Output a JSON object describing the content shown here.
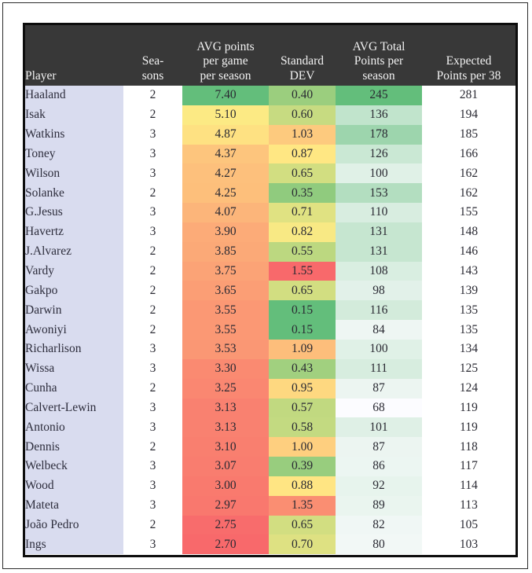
{
  "table": {
    "columns": [
      {
        "key": "player",
        "label": "Player",
        "lines": [
          "Player"
        ]
      },
      {
        "key": "seasons",
        "label": "Seasons",
        "lines": [
          "Sea-",
          "sons"
        ]
      },
      {
        "key": "avg_ppg",
        "label": "AVG points per game per season",
        "lines": [
          "AVG points",
          "per game",
          "per season"
        ]
      },
      {
        "key": "std_dev",
        "label": "Standard DEV",
        "lines": [
          "Standard",
          "DEV"
        ]
      },
      {
        "key": "avg_total",
        "label": "AVG Total Points per season",
        "lines": [
          "AVG Total",
          "Points per",
          "season"
        ]
      },
      {
        "key": "expected",
        "label": "Expected Points per 38",
        "lines": [
          "Expected",
          "Points per 38"
        ]
      }
    ],
    "rows": [
      {
        "player": "Haaland",
        "seasons": "2",
        "avg_ppg": "7.40",
        "std_dev": "0.40",
        "avg_total": "245",
        "expected": "281"
      },
      {
        "player": "Isak",
        "seasons": "2",
        "avg_ppg": "5.10",
        "std_dev": "0.60",
        "avg_total": "136",
        "expected": "194"
      },
      {
        "player": "Watkins",
        "seasons": "3",
        "avg_ppg": "4.87",
        "std_dev": "1.03",
        "avg_total": "178",
        "expected": "185"
      },
      {
        "player": "Toney",
        "seasons": "3",
        "avg_ppg": "4.37",
        "std_dev": "0.87",
        "avg_total": "126",
        "expected": "166"
      },
      {
        "player": "Wilson",
        "seasons": "3",
        "avg_ppg": "4.27",
        "std_dev": "0.65",
        "avg_total": "100",
        "expected": "162"
      },
      {
        "player": "Solanke",
        "seasons": "2",
        "avg_ppg": "4.25",
        "std_dev": "0.35",
        "avg_total": "153",
        "expected": "162"
      },
      {
        "player": "G.Jesus",
        "seasons": "3",
        "avg_ppg": "4.07",
        "std_dev": "0.71",
        "avg_total": "110",
        "expected": "155"
      },
      {
        "player": "Havertz",
        "seasons": "3",
        "avg_ppg": "3.90",
        "std_dev": "0.82",
        "avg_total": "131",
        "expected": "148"
      },
      {
        "player": "J.Alvarez",
        "seasons": "2",
        "avg_ppg": "3.85",
        "std_dev": "0.55",
        "avg_total": "131",
        "expected": "146"
      },
      {
        "player": "Vardy",
        "seasons": "2",
        "avg_ppg": "3.75",
        "std_dev": "1.55",
        "avg_total": "108",
        "expected": "143"
      },
      {
        "player": "Gakpo",
        "seasons": "2",
        "avg_ppg": "3.65",
        "std_dev": "0.65",
        "avg_total": "98",
        "expected": "139"
      },
      {
        "player": "Darwin",
        "seasons": "2",
        "avg_ppg": "3.55",
        "std_dev": "0.15",
        "avg_total": "116",
        "expected": "135"
      },
      {
        "player": "Awoniyi",
        "seasons": "2",
        "avg_ppg": "3.55",
        "std_dev": "0.15",
        "avg_total": "84",
        "expected": "135"
      },
      {
        "player": "Richarlison",
        "seasons": "3",
        "avg_ppg": "3.53",
        "std_dev": "1.09",
        "avg_total": "100",
        "expected": "134"
      },
      {
        "player": "Wissa",
        "seasons": "3",
        "avg_ppg": "3.30",
        "std_dev": "0.43",
        "avg_total": "111",
        "expected": "125"
      },
      {
        "player": "Cunha",
        "seasons": "2",
        "avg_ppg": "3.25",
        "std_dev": "0.95",
        "avg_total": "87",
        "expected": "124"
      },
      {
        "player": "Calvert-Lewin",
        "seasons": "3",
        "avg_ppg": "3.13",
        "std_dev": "0.57",
        "avg_total": "68",
        "expected": "119"
      },
      {
        "player": "Antonio",
        "seasons": "3",
        "avg_ppg": "3.13",
        "std_dev": "0.58",
        "avg_total": "101",
        "expected": "119"
      },
      {
        "player": "Dennis",
        "seasons": "2",
        "avg_ppg": "3.10",
        "std_dev": "1.00",
        "avg_total": "87",
        "expected": "118"
      },
      {
        "player": "Welbeck",
        "seasons": "3",
        "avg_ppg": "3.07",
        "std_dev": "0.39",
        "avg_total": "86",
        "expected": "117"
      },
      {
        "player": "Wood",
        "seasons": "3",
        "avg_ppg": "3.00",
        "std_dev": "0.88",
        "avg_total": "92",
        "expected": "114"
      },
      {
        "player": "Mateta",
        "seasons": "3",
        "avg_ppg": "2.97",
        "std_dev": "1.35",
        "avg_total": "89",
        "expected": "113"
      },
      {
        "player": "João Pedro",
        "seasons": "2",
        "avg_ppg": "2.75",
        "std_dev": "0.65",
        "avg_total": "82",
        "expected": "105"
      },
      {
        "player": "Ings",
        "seasons": "3",
        "avg_ppg": "2.70",
        "std_dev": "0.70",
        "avg_total": "80",
        "expected": "103"
      }
    ]
  },
  "heatmap": {
    "avg_ppg": {
      "direction": "high-is-green",
      "min": 2.7,
      "max": 7.4,
      "stops": [
        "#f8696b",
        "#ffeb84",
        "#63be7b"
      ]
    },
    "std_dev": {
      "direction": "low-is-green",
      "min": 0.15,
      "max": 1.55,
      "stops": [
        "#f8696b",
        "#ffeb84",
        "#63be7b"
      ]
    },
    "avg_total": {
      "direction": "high-is-green",
      "min": 68,
      "max": 245,
      "stops": [
        "#fcfcff",
        "#63be7b"
      ]
    }
  },
  "colors": {
    "header_bg": "#383838",
    "header_text": "#f2f2f2",
    "player_bg": "#d9dcef",
    "plain_bg": "#ffffff",
    "text": "#2a2a33",
    "table_border": "#0d0d0d",
    "page_border": "#2b2b2b"
  }
}
